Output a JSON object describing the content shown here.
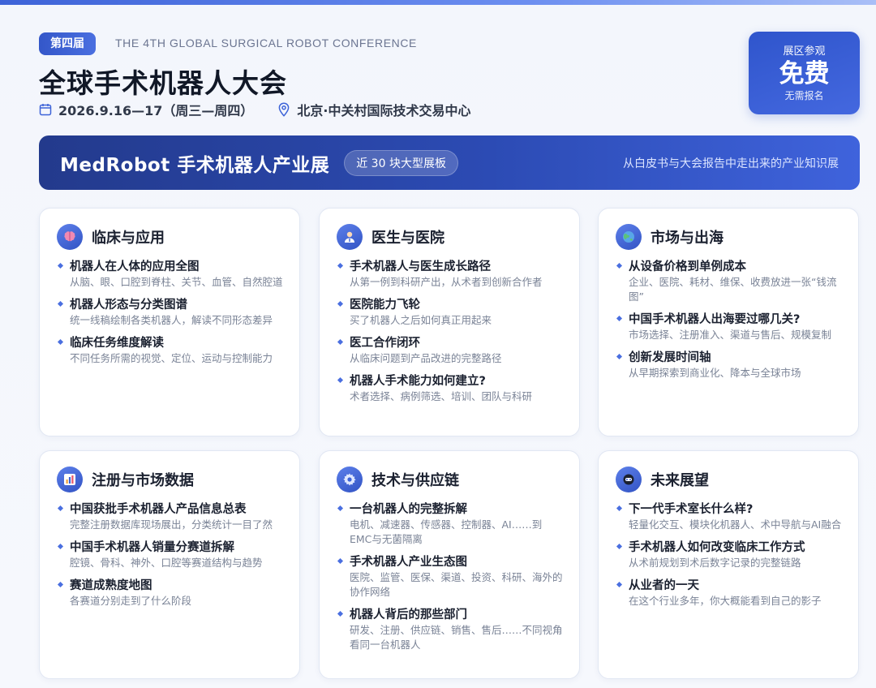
{
  "header": {
    "edition_badge": "第四届",
    "english_title": "THE 4TH GLOBAL SURGICAL ROBOT CONFERENCE",
    "title": "全球手术机器人大会",
    "date": "2026.9.16—17（周三—周四）",
    "venue": "北京·中关村国际技术交易中心",
    "free_box": {
      "top": "展区参观",
      "big": "免费",
      "bottom": "无需报名"
    }
  },
  "banner": {
    "title": "MedRobot 手术机器人产业展",
    "pill": "近 30 块大型展板",
    "subtitle": "从白皮书与大会报告中走出来的产业知识展"
  },
  "cards": [
    {
      "title": "临床与应用",
      "icon": "brain-icon",
      "entries": [
        {
          "title": "机器人在人体的应用全图",
          "desc": "从脑、眼、口腔到脊柱、关节、血管、自然腔道"
        },
        {
          "title": "机器人形态与分类图谱",
          "desc": "统一线稿绘制各类机器人，解读不同形态差异"
        },
        {
          "title": "临床任务维度解读",
          "desc": "不同任务所需的视觉、定位、运动与控制能力"
        }
      ]
    },
    {
      "title": "医生与医院",
      "icon": "doctor-icon",
      "entries": [
        {
          "title": "手术机器人与医生成长路径",
          "desc": "从第一例到科研产出，从术者到创新合作者"
        },
        {
          "title": "医院能力飞轮",
          "desc": "买了机器人之后如何真正用起来"
        },
        {
          "title": "医工合作闭环",
          "desc": "从临床问题到产品改进的完整路径"
        },
        {
          "title": "机器人手术能力如何建立?",
          "desc": "术者选择、病例筛选、培训、团队与科研"
        }
      ]
    },
    {
      "title": "市场与出海",
      "icon": "globe-icon",
      "entries": [
        {
          "title": "从设备价格到单例成本",
          "desc": "企业、医院、耗材、维保、收费放进一张“钱流图”"
        },
        {
          "title": "中国手术机器人出海要过哪几关?",
          "desc": "市场选择、注册准入、渠道与售后、规模复制"
        },
        {
          "title": "创新发展时间轴",
          "desc": "从早期探索到商业化、降本与全球市场"
        }
      ]
    },
    {
      "title": "注册与市场数据",
      "icon": "bar-chart-icon",
      "entries": [
        {
          "title": "中国获批手术机器人产品信息总表",
          "desc": "完整注册数据库现场展出，分类统计一目了然"
        },
        {
          "title": "中国手术机器人销量分赛道拆解",
          "desc": "腔镜、骨科、神外、口腔等赛道结构与趋势"
        },
        {
          "title": "赛道成熟度地图",
          "desc": "各赛道分别走到了什么阶段"
        }
      ]
    },
    {
      "title": "技术与供应链",
      "icon": "gear-icon",
      "entries": [
        {
          "title": "一台机器人的完整拆解",
          "desc": "电机、减速器、传感器、控制器、AI……到EMC与无菌隔离"
        },
        {
          "title": "手术机器人产业生态图",
          "desc": "医院、监管、医保、渠道、投资、科研、海外的协作网络"
        },
        {
          "title": "机器人背后的那些部门",
          "desc": "研发、注册、供应链、销售、售后……不同视角看同一台机器人"
        }
      ]
    },
    {
      "title": "未来展望",
      "icon": "robot-icon",
      "entries": [
        {
          "title": "下一代手术室长什么样?",
          "desc": "轻量化交互、模块化机器人、术中导航与AI融合"
        },
        {
          "title": "手术机器人如何改变临床工作方式",
          "desc": "从术前规划到术后数字记录的完整链路"
        },
        {
          "title": "从业者的一天",
          "desc": "在这个行业多年，你大概能看到自己的影子"
        }
      ]
    }
  ]
}
